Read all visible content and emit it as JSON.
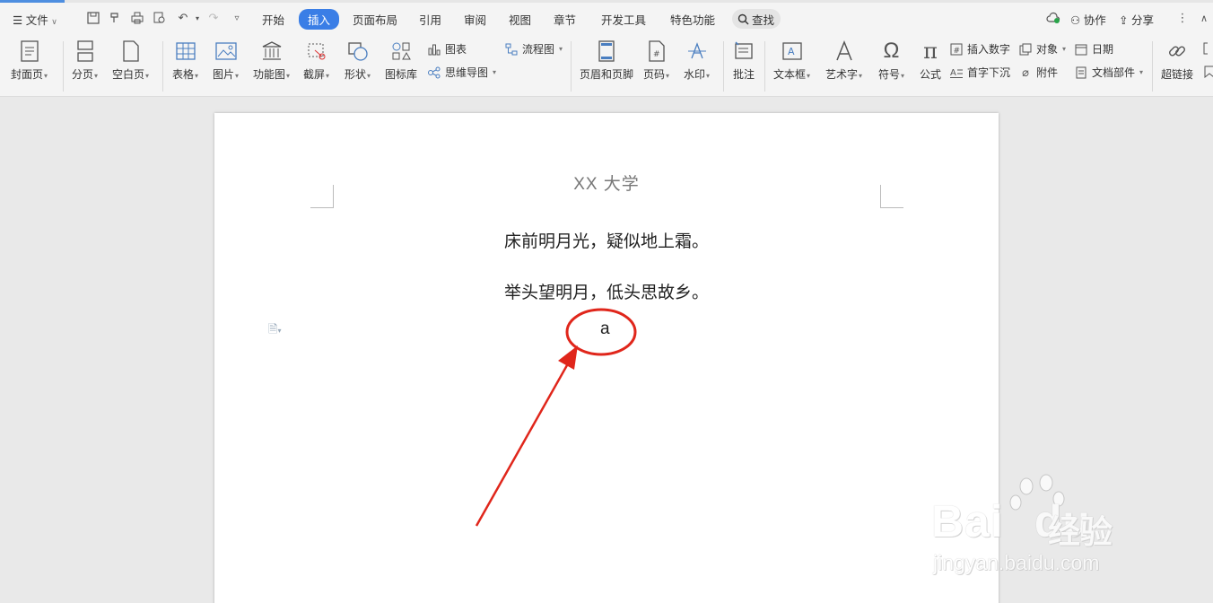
{
  "menu": {
    "file_label": "文件",
    "tabs": [
      "开始",
      "插入",
      "页面布局",
      "引用",
      "审阅",
      "视图",
      "章节",
      "开发工具",
      "特色功能"
    ],
    "active_tab": "插入",
    "search_label": "查找",
    "collab_label": "协作",
    "share_label": "分享"
  },
  "ribbon": {
    "cover": "封面页",
    "page_break": "分页",
    "blank_page": "空白页",
    "table": "表格",
    "picture": "图片",
    "func_chart": "功能图",
    "screenshot": "截屏",
    "shape": "形状",
    "icon_lib": "图标库",
    "chart": "图表",
    "mindmap": "思维导图",
    "flowchart": "流程图",
    "header_footer": "页眉和页脚",
    "page_num": "页码",
    "watermark": "水印",
    "comment": "批注",
    "textbox": "文本框",
    "wordart": "艺术字",
    "symbol": "符号",
    "formula": "公式",
    "insert_number": "插入数字",
    "drop_cap": "首字下沉",
    "object": "对象",
    "attachment": "附件",
    "date": "日期",
    "doc_parts": "文档部件",
    "hyperlink": "超链接"
  },
  "document": {
    "header": "XX 大学",
    "line1": "床前明月光，疑似地上霜。",
    "line2": "举头望明月，低头思故乡。",
    "char": "a"
  },
  "watermark": {
    "brand": "Bai",
    "brand2": "du",
    "cn": "经验",
    "url": "jingyan.baidu.com"
  },
  "colors": {
    "accent": "#3a7ee6",
    "annotation": "#e0261b"
  }
}
